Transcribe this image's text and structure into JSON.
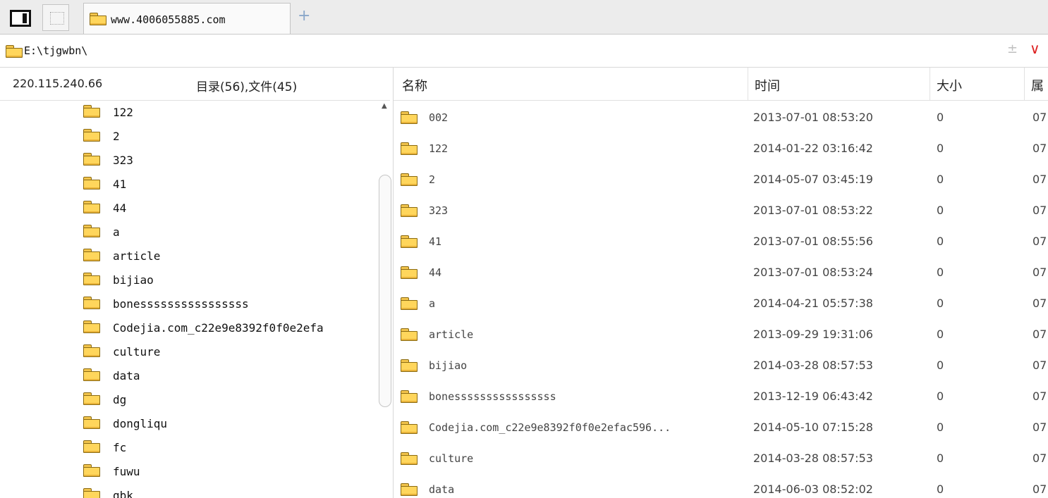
{
  "tabbar": {
    "panel_icon": "panel-layout-icon",
    "blank_icon": "dotted-box-icon",
    "active_tab": {
      "label": "www.4006055885.com",
      "icon": "folder-icon"
    },
    "new_tab_symbol": "+"
  },
  "address": {
    "path": "E:\\tjgwbn\\",
    "plus_minus": "±",
    "dropdown": "∨"
  },
  "left_pane": {
    "ip": "220.115.240.66",
    "summary": "目录(56),文件(45)",
    "tree": [
      "122",
      "2",
      "323",
      "41",
      "44",
      "a",
      "article",
      "bijiao",
      "bonessssssssssssssss",
      "Codejia.com_c22e9e8392f0f0e2efa",
      "culture",
      "data",
      "dg",
      "dongliqu",
      "fc",
      "fuwu",
      "gbk"
    ]
  },
  "columns": {
    "name": "名称",
    "time": "时间",
    "size": "大小",
    "attr": "属"
  },
  "files": [
    {
      "name": "002",
      "time": "2013-07-01 08:53:20",
      "size": "0",
      "attr": "07"
    },
    {
      "name": "122",
      "time": "2014-01-22 03:16:42",
      "size": "0",
      "attr": "07"
    },
    {
      "name": "2",
      "time": "2014-05-07 03:45:19",
      "size": "0",
      "attr": "07"
    },
    {
      "name": "323",
      "time": "2013-07-01 08:53:22",
      "size": "0",
      "attr": "07"
    },
    {
      "name": "41",
      "time": "2013-07-01 08:55:56",
      "size": "0",
      "attr": "07"
    },
    {
      "name": "44",
      "time": "2013-07-01 08:53:24",
      "size": "0",
      "attr": "07"
    },
    {
      "name": "a",
      "time": "2014-04-21 05:57:38",
      "size": "0",
      "attr": "07"
    },
    {
      "name": "article",
      "time": "2013-09-29 19:31:06",
      "size": "0",
      "attr": "07"
    },
    {
      "name": "bijiao",
      "time": "2014-03-28 08:57:53",
      "size": "0",
      "attr": "07"
    },
    {
      "name": "bonessssssssssssssss",
      "time": "2013-12-19 06:43:42",
      "size": "0",
      "attr": "07"
    },
    {
      "name": "Codejia.com_c22e9e8392f0f0e2efac596...",
      "time": "2014-05-10 07:15:28",
      "size": "0",
      "attr": "07"
    },
    {
      "name": "culture",
      "time": "2014-03-28 08:57:53",
      "size": "0",
      "attr": "07"
    },
    {
      "name": "data",
      "time": "2014-06-03 08:52:02",
      "size": "0",
      "attr": "07"
    }
  ],
  "colors": {
    "folder": "#ffd65c",
    "accent_red": "#dd2222",
    "plus_blue": "#8aa7c9"
  }
}
